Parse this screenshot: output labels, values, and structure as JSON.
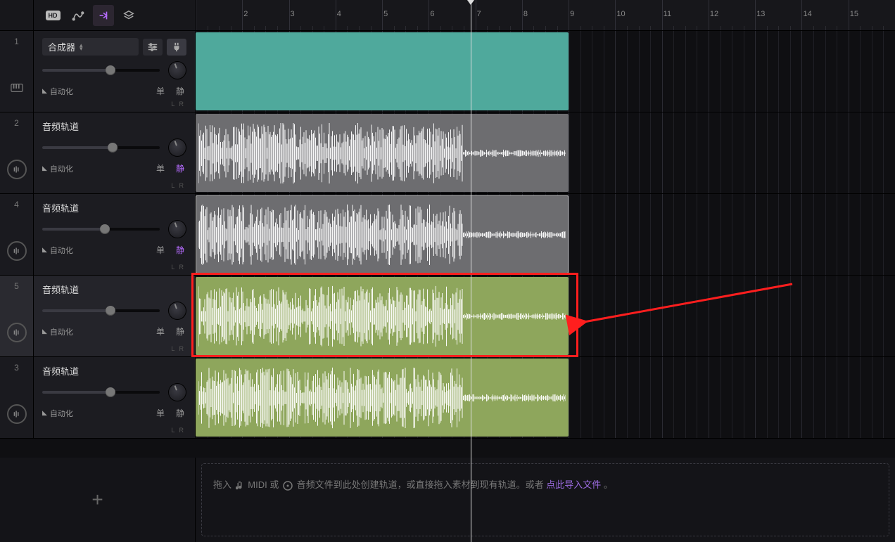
{
  "ruler": {
    "start": 1,
    "end": 16,
    "playhead_bar": 6.9
  },
  "toolbar": {
    "hd": "HD"
  },
  "tracks": [
    {
      "idx": "1",
      "name": "合成器",
      "selector": true,
      "icon": "piano",
      "automation": "自动化",
      "solo": "单",
      "mute": "静",
      "mute_active": false,
      "slider": 58,
      "clip": {
        "type": "synth",
        "start": 1,
        "end": 9
      }
    },
    {
      "idx": "2",
      "name": "音频轨道",
      "icon": "wave",
      "automation": "自动化",
      "solo": "单",
      "mute": "静",
      "mute_active": true,
      "slider": 60,
      "clip": {
        "type": "gray",
        "start": 1,
        "end": 9,
        "waveform": true
      }
    },
    {
      "idx": "4",
      "name": "音频轨道",
      "icon": "wave",
      "automation": "自动化",
      "solo": "单",
      "mute": "静",
      "mute_active": true,
      "slider": 53,
      "clip": {
        "type": "gray",
        "start": 1,
        "end": 9,
        "waveform": true,
        "selected": true
      }
    },
    {
      "idx": "5",
      "name": "音频轨道",
      "icon": "wave",
      "automation": "自动化",
      "solo": "单",
      "mute": "静",
      "mute_active": false,
      "slider": 58,
      "clip": {
        "type": "green",
        "start": 1,
        "end": 9,
        "waveform": true
      },
      "highlight": true,
      "selected_panel": true
    },
    {
      "idx": "3",
      "name": "音频轨道",
      "icon": "wave",
      "automation": "自动化",
      "solo": "单",
      "mute": "静",
      "mute_active": false,
      "slider": 58,
      "clip": {
        "type": "green",
        "start": 1,
        "end": 9,
        "waveform": true
      }
    }
  ],
  "dropzone": {
    "prefix": "拖入",
    "midi": "MIDI",
    "or1": "或",
    "audio_hint": "音频文件到此处创建轨道，或直接拖入素材到现有轨道。或者",
    "link": "点此导入文件",
    "suffix": "。"
  },
  "labels": {
    "lr": "L  R"
  }
}
